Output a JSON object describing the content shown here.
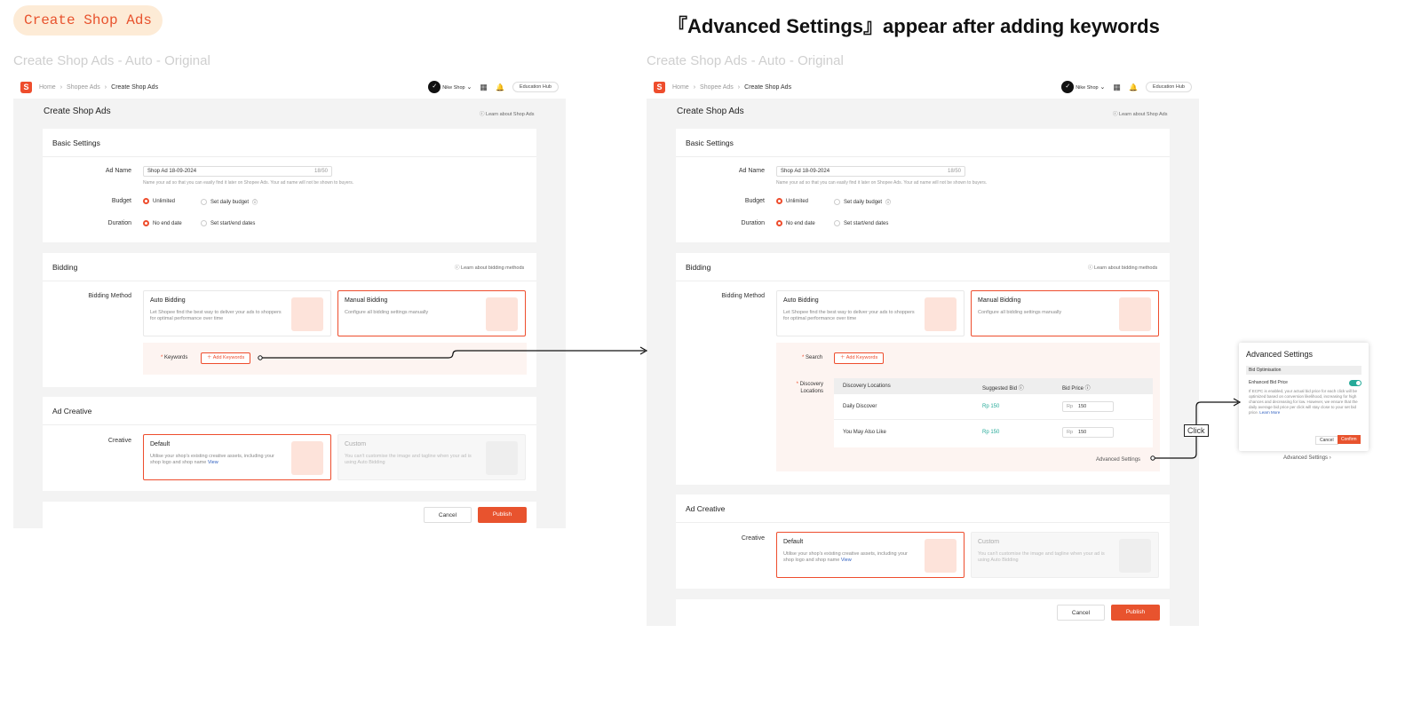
{
  "pill": "Create Shop Ads",
  "headline": "『Advanced Settings』appear after adding keywords",
  "subtitle": "Create Shop Ads - Auto - Original",
  "breadcrumb": {
    "home": "Home",
    "ads": "Shopee Ads",
    "current": "Create Shop Ads"
  },
  "topbar": {
    "shop": "Nike Shop",
    "edu": "Education Hub"
  },
  "page_title": "Create Shop Ads",
  "learn_shop_ads": "Learn about Shop Ads",
  "basic": {
    "title": "Basic Settings",
    "ad_name_label": "Ad Name",
    "ad_name_value": "Shop Ad 18-09-2024",
    "ad_name_count": "18/50",
    "ad_name_help": "Name your ad so that you can easily find it later on Shopee Ads. Your ad name will not be shown to buyers.",
    "budget_label": "Budget",
    "budget_unlimited": "Unlimited",
    "budget_daily": "Set daily budget",
    "duration_label": "Duration",
    "duration_none": "No end date",
    "duration_dates": "Set start/end dates"
  },
  "bidding": {
    "title": "Bidding",
    "learn": "Learn about bidding methods",
    "method_label": "Bidding Method",
    "auto_title": "Auto Bidding",
    "auto_desc": "Let Shopee find the best way to deliver your ads to shoppers for optimal performance over time",
    "manual_title": "Manual Bidding",
    "manual_desc": "Configure all bidding settings manually",
    "keywords_label": "Keywords",
    "search_label": "Search",
    "add_keywords": "Add Keywords",
    "discovery_label1": "Discovery",
    "discovery_label2": "Locations",
    "advanced_link": "Advanced Settings"
  },
  "table": {
    "col1": "Discovery Locations",
    "col2": "Suggested Bid",
    "col3": "Bid Price",
    "rows": [
      {
        "loc": "Daily Discover",
        "sug": "Rp 150",
        "cur": "Rp",
        "bid": "150"
      },
      {
        "loc": "You May Also Like",
        "sug": "Rp 150",
        "cur": "Rp",
        "bid": "150"
      }
    ]
  },
  "creative": {
    "title": "Ad Creative",
    "label": "Creative",
    "default_title": "Default",
    "default_desc": "Utilise your shop's existing creative assets, including your shop logo and shop name",
    "default_view": "View",
    "custom_title": "Custom",
    "custom_desc": "You can't customise the image and tagline when your ad is using Auto Bidding"
  },
  "footer": {
    "cancel": "Cancel",
    "publish": "Publish"
  },
  "popup": {
    "title": "Advanced Settings",
    "section": "Bid Optimisation",
    "toggle_label": "Enhanced Bid Price",
    "desc": "If ECPC is enabled, your actual bid price for each click will be optimized based on conversion likelihood, increasing for high chances and decreasing for low. However, we ensure that the daily average bid price per click will stay close to your set bid price.",
    "learn_more": "Learn More",
    "cancel": "Cancel",
    "confirm": "Confirm",
    "below_link": "Advanced Settings"
  },
  "click_label": "Click",
  "colors": {
    "accent": "#ee4d2d",
    "green": "#26aa99"
  }
}
